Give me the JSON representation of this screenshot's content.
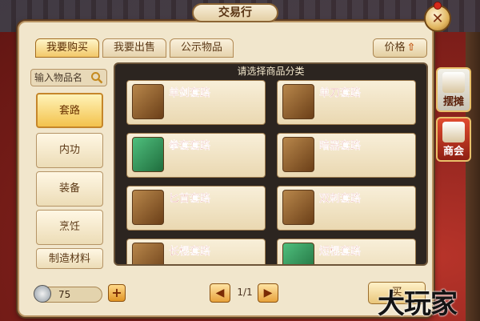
{
  "window": {
    "title": "交易行"
  },
  "tabs": [
    {
      "label": "我要购买",
      "active": true
    },
    {
      "label": "我要出售",
      "active": false
    },
    {
      "label": "公示物品",
      "active": false
    }
  ],
  "sort": {
    "label": "价格",
    "direction_icon": "arrow-up-icon"
  },
  "search": {
    "placeholder": "输入物品名",
    "icon": "search-icon"
  },
  "categories": [
    {
      "label": "套路",
      "active": true
    },
    {
      "label": "内功",
      "active": false
    },
    {
      "label": "装备",
      "active": false
    },
    {
      "label": "烹饪",
      "active": false
    },
    {
      "label": "制造材料",
      "active": false
    }
  ],
  "grid": {
    "header": "请选择商品分类",
    "items": [
      {
        "label": "单剑套路"
      },
      {
        "label": "单刀套路"
      },
      {
        "label": "拳套套路"
      },
      {
        "label": "暗器套路"
      },
      {
        "label": "匕首套路"
      },
      {
        "label": "双刺套路"
      },
      {
        "label": "长棍套路"
      },
      {
        "label": "短棍套路"
      }
    ]
  },
  "currency": {
    "amount": "75",
    "add_icon": "plus-icon"
  },
  "pagination": {
    "current": "1/1",
    "prev_icon": "chevron-left-icon",
    "next_icon": "chevron-right-icon"
  },
  "side_buttons": [
    {
      "label": "摆摊",
      "active": true
    },
    {
      "label": "商会",
      "active": false
    }
  ],
  "bottom_action": {
    "label": "买"
  },
  "watermark": "大玩家"
}
